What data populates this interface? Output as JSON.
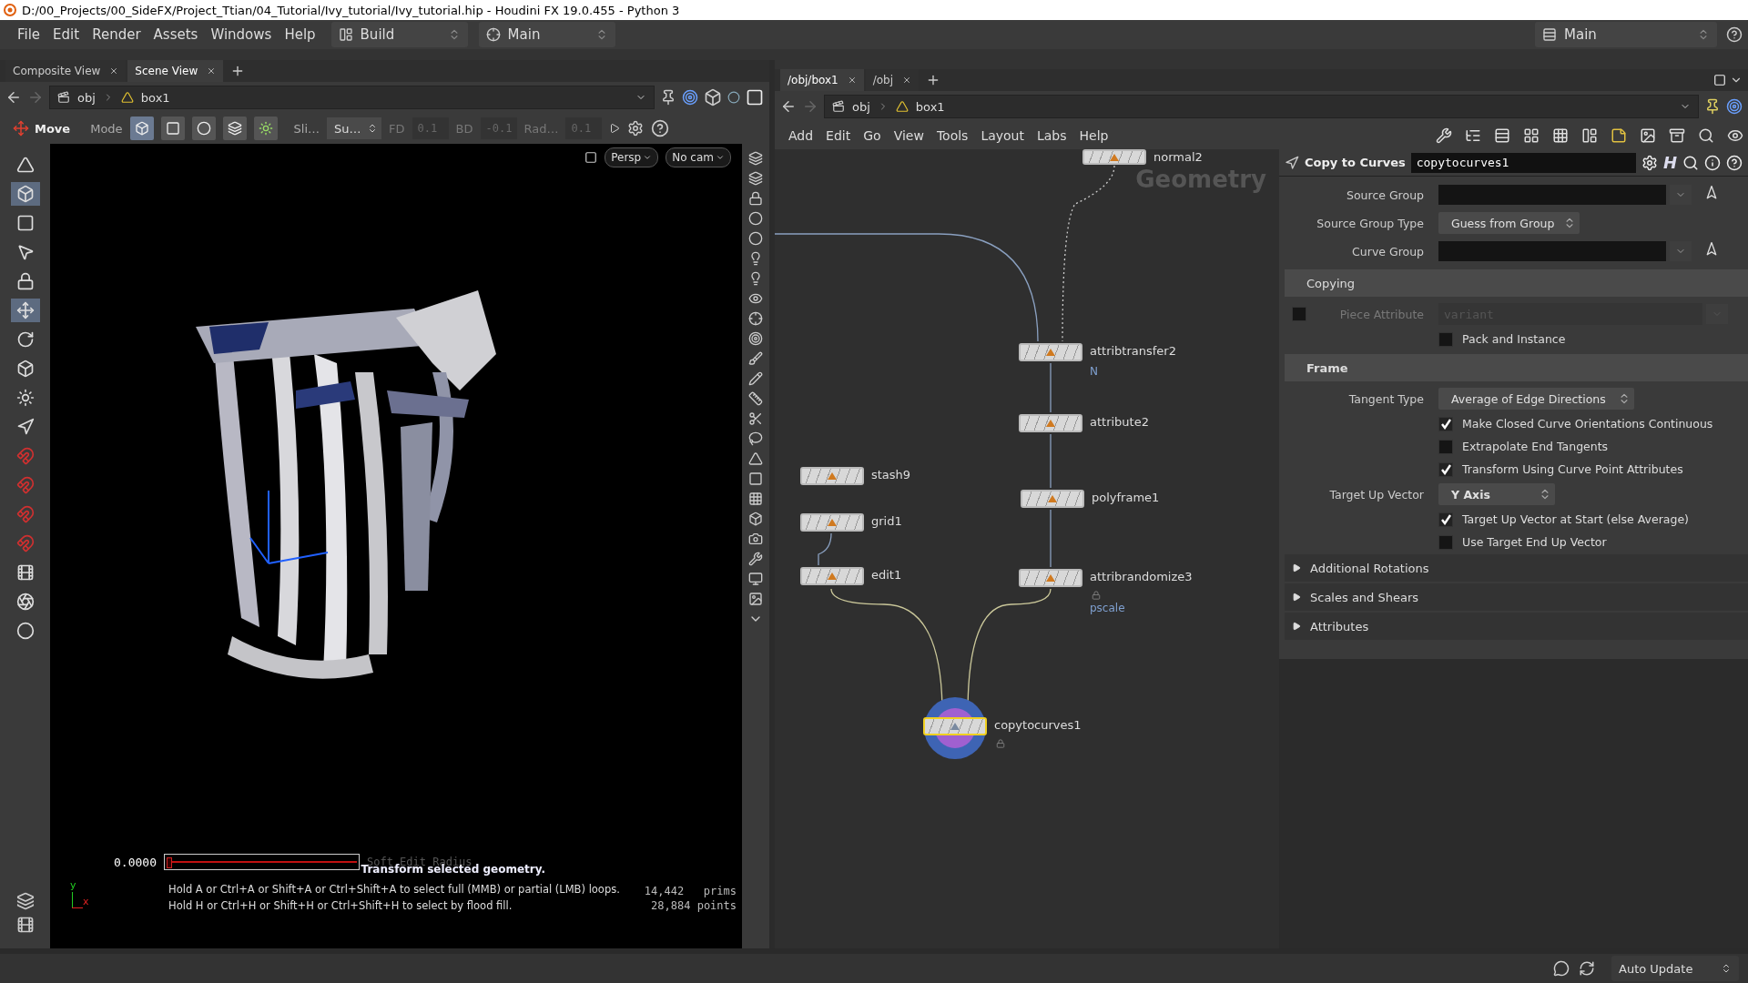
{
  "title_bar": {
    "title": "D:/00_Projects/00_SideFX/Project_Ttian/04_Tutorial/Ivy_tutorial/Ivy_tutorial.hip - Houdini FX 19.0.455 - Python 3"
  },
  "menu_bar": {
    "items": [
      "File",
      "Edit",
      "Render",
      "Assets",
      "Windows",
      "Help"
    ],
    "shelf_set": "Build",
    "desktop": "Main",
    "right_desktop": "Main"
  },
  "scene_pane": {
    "tabs": [
      {
        "label": "Composite View",
        "selected": false
      },
      {
        "label": "Scene View",
        "selected": true
      }
    ],
    "path": [
      "obj",
      "box1"
    ],
    "toolbar": {
      "tool": "Move",
      "mode": "Mode",
      "select_modes": [
        {
          "selected": true
        },
        {
          "selected": false
        },
        {
          "selected": false
        },
        {
          "selected": false
        }
      ],
      "slide": "Sli…",
      "sub": "Su…",
      "fields": [
        {
          "label": "FD",
          "value": "0.1",
          "disabled": true
        },
        {
          "label": "BD",
          "value": "-0.1",
          "disabled": true
        },
        {
          "label": "Rad…",
          "value": "0.1",
          "disabled": true
        }
      ]
    },
    "viewport": {
      "camera": "Persp",
      "cam": "No cam",
      "radius_value": "0.0000",
      "level": 0,
      "radius_label": "Soft Edit Radius",
      "tooltip": "Transform selected geometry.",
      "hints": [
        "Hold A or Ctrl+A or Shift+A or Ctrl+Shift+A to select full (MMB) or partial (LMB) loops.",
        "Hold H or Ctrl+H or Shift+H or Ctrl+Shift+H to select by flood fill."
      ],
      "axes": [
        "y",
        "x"
      ],
      "stats": [
        {
          "value": "14,442",
          "unit": "prims"
        },
        {
          "value": "28,884",
          "unit": "points"
        }
      ]
    }
  },
  "network_pane": {
    "tabs": [
      {
        "label": "/obj/box1",
        "selected": true
      },
      {
        "label": "/obj",
        "selected": false
      }
    ],
    "path": [
      "obj",
      "box1"
    ],
    "menu": [
      "Add",
      "Edit",
      "Go",
      "View",
      "Tools",
      "Layout",
      "Labs",
      "Help"
    ],
    "context": "Geometry",
    "nodes": [
      {
        "name": "normal2",
        "selected": false,
        "locked": false
      },
      {
        "name": "attribtransfer2",
        "note": "N",
        "selected": false,
        "locked": false
      },
      {
        "name": "attribute2",
        "selected": false,
        "locked": false
      },
      {
        "name": "stash9",
        "selected": false,
        "locked": false
      },
      {
        "name": "polyframe1",
        "selected": false,
        "locked": false
      },
      {
        "name": "grid1",
        "selected": false,
        "locked": false
      },
      {
        "name": "edit1",
        "selected": false,
        "locked": false
      },
      {
        "name": "attribrandomize3",
        "note": "pscale",
        "selected": false,
        "locked": true
      },
      {
        "name": "copytocurves1",
        "selected": true,
        "locked": true
      }
    ]
  },
  "parameters": {
    "node_type": "Copy to Curves",
    "node_name": "copytocurves1",
    "asset_button": "H",
    "rows": [
      {
        "kind": "group",
        "label": "Source Group"
      },
      {
        "kind": "menu",
        "label": "Source Group Type",
        "value": "Guess from Group",
        "bold": false
      },
      {
        "kind": "group",
        "label": "Curve Group"
      },
      {
        "kind": "section",
        "label": "Copying",
        "bold": false
      },
      {
        "kind": "attribute",
        "label": "Piece Attribute",
        "value": "variant",
        "checked": false,
        "disabled": true
      },
      {
        "kind": "toggle",
        "label": "Pack and Instance",
        "checked": false
      },
      {
        "kind": "section",
        "label": "Frame",
        "bold": true
      },
      {
        "kind": "menu",
        "label": "Tangent Type",
        "value": "Average of Edge Directions",
        "bold": false
      },
      {
        "kind": "toggle",
        "label": "Make Closed Curve Orientations Continuous",
        "checked": true
      },
      {
        "kind": "toggle",
        "label": "Extrapolate End Tangents",
        "checked": false
      },
      {
        "kind": "toggle",
        "label": "Transform Using Curve Point Attributes",
        "checked": true
      },
      {
        "kind": "menu",
        "label": "Target Up Vector",
        "value": "Y Axis",
        "bold": true
      },
      {
        "kind": "toggle",
        "label": "Target Up Vector at Start (else Average)",
        "checked": true
      },
      {
        "kind": "toggle",
        "label": "Use Target End Up Vector",
        "checked": false
      },
      {
        "kind": "folder",
        "label": "Additional Rotations",
        "expanded": false
      },
      {
        "kind": "folder",
        "label": "Scales and Shears",
        "expanded": false
      },
      {
        "kind": "folder",
        "label": "Attributes",
        "expanded": false
      }
    ]
  },
  "status_bar": {
    "update_mode": "Auto Update"
  }
}
